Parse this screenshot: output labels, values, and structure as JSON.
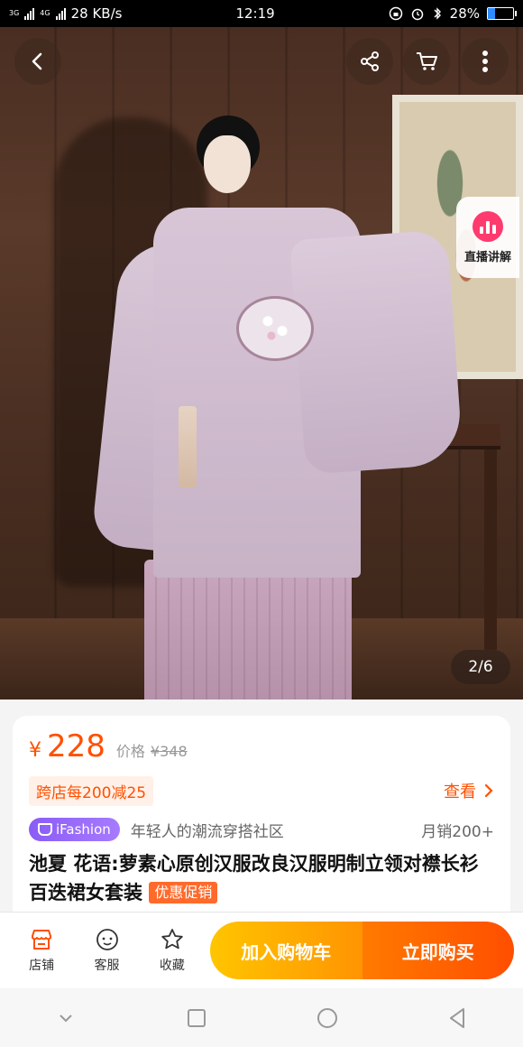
{
  "status_bar": {
    "network_left": "3G",
    "network_right": "4G",
    "speed": "28 KB/s",
    "time": "12:19",
    "battery": "28%",
    "battery_level": 0.28
  },
  "hero": {
    "page_indicator": "2/6",
    "live_label": "直播讲解"
  },
  "product": {
    "currency": "¥",
    "price": "228",
    "original_label": "价格",
    "original_price": "¥348",
    "promo": "跨店每200减25",
    "promo_link": "查看",
    "brand_tag": "iFashion",
    "community": "年轻人的潮流穿搭社区",
    "monthly_sales": "月销200+",
    "title": "池夏 花语:萝素心原创汉服改良汉服明制立领对襟长衫百迭裙女套装",
    "discount_badge": "优惠促销"
  },
  "actions": {
    "store": "店铺",
    "service": "客服",
    "favorite": "收藏",
    "add_to_cart": "加入购物车",
    "buy_now": "立即购买"
  },
  "colors": {
    "accent": "#ff5000",
    "cart_button": "#ffb000",
    "buy_button": "#ff5a00",
    "brand_tag": "#8a5cf6"
  },
  "icons": [
    "back-icon",
    "share-icon",
    "cart-icon",
    "more-icon",
    "live-icon",
    "store-icon",
    "service-icon",
    "star-icon",
    "nav-back-icon",
    "nav-home-icon",
    "nav-recent-icon"
  ]
}
